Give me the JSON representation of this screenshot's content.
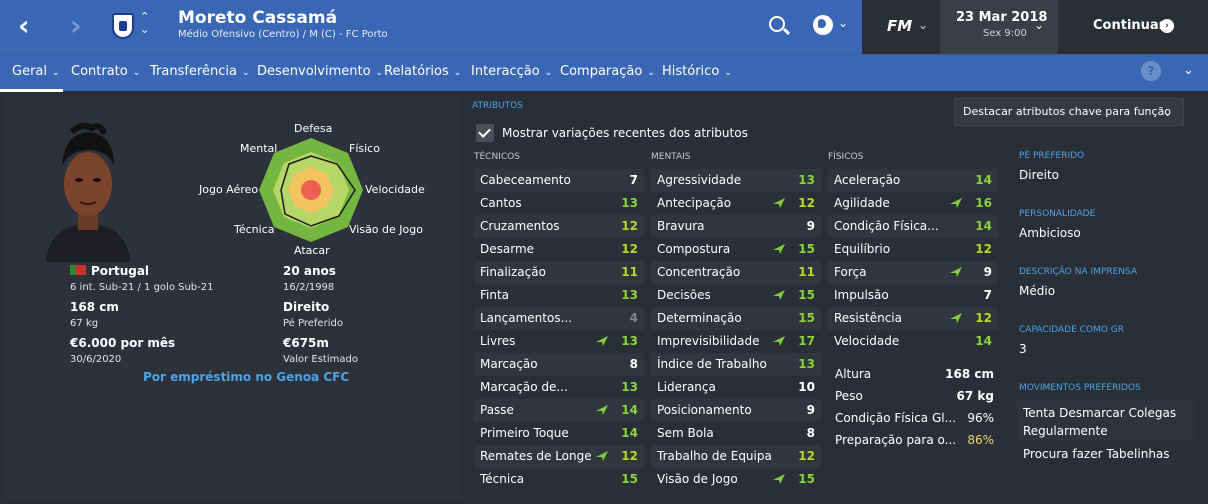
{
  "header": {
    "player_name": "Moreto Cassamá",
    "player_sub": "Médio Ofensivo (Centro) / M (C) - FC Porto",
    "fm_logo": "FM",
    "date": "23 Mar 2018",
    "day_time": "Sex 9:00",
    "continue_label": "Continuar",
    "icons": [
      "back-arrow-icon",
      "forward-arrow-icon",
      "club-crest-icon",
      "search-icon",
      "globe-icon",
      "help-icon"
    ]
  },
  "tabs": [
    {
      "label": "Geral"
    },
    {
      "label": "Contrato"
    },
    {
      "label": "Transferência"
    },
    {
      "label": "Desenvolvimento"
    },
    {
      "label": "Relatórios"
    },
    {
      "label": "Interacção"
    },
    {
      "label": "Comparação"
    },
    {
      "label": "Histórico"
    }
  ],
  "profile": {
    "radar_labels": {
      "defesa": "Defesa",
      "mental": "Mental",
      "fisico": "Físico",
      "jogo_aereo": "Jogo Aéreo",
      "velocidade": "Velocidade",
      "tecnica": "Técnica",
      "visao": "Visão de Jogo",
      "atacar": "Atacar"
    },
    "nationality": "Portugal",
    "caps": "6 int. Sub-21 / 1 golo Sub-21",
    "age": "20 anos",
    "dob": "16/2/1998",
    "height": "168 cm",
    "weight": "67 kg",
    "foot": "Direito",
    "foot_label": "Pé Preferido",
    "wage": "€6.000 por mês",
    "contract_end": "30/6/2020",
    "value": "€675m",
    "value_label": "Valor Estimado",
    "loan": "Por empréstimo no Genoa CFC"
  },
  "attributes": {
    "section_title": "ATRIBUTOS",
    "show_changes_label": "Mostrar variações recentes dos atributos",
    "highlight_button": "Destacar atributos chave para função",
    "columns": [
      {
        "title": "TÉCNICOS",
        "rows": [
          {
            "name": "Cabeceamento",
            "value": "7",
            "up": false
          },
          {
            "name": "Cantos",
            "value": "13",
            "up": false
          },
          {
            "name": "Cruzamentos",
            "value": "12",
            "up": false
          },
          {
            "name": "Desarme",
            "value": "12",
            "up": false
          },
          {
            "name": "Finalização",
            "value": "11",
            "up": false
          },
          {
            "name": "Finta",
            "value": "13",
            "up": false
          },
          {
            "name": "Lançamentos...",
            "value": "4",
            "up": false
          },
          {
            "name": "Livres",
            "value": "13",
            "up": true
          },
          {
            "name": "Marcação",
            "value": "8",
            "up": false
          },
          {
            "name": "Marcação de...",
            "value": "13",
            "up": false
          },
          {
            "name": "Passe",
            "value": "14",
            "up": true
          },
          {
            "name": "Primeiro Toque",
            "value": "14",
            "up": false
          },
          {
            "name": "Remates de Longe",
            "value": "12",
            "up": true
          },
          {
            "name": "Técnica",
            "value": "15",
            "up": false
          }
        ]
      },
      {
        "title": "MENTAIS",
        "rows": [
          {
            "name": "Agressividade",
            "value": "13",
            "up": false
          },
          {
            "name": "Antecipação",
            "value": "12",
            "up": true
          },
          {
            "name": "Bravura",
            "value": "9",
            "up": false
          },
          {
            "name": "Compostura",
            "value": "15",
            "up": true
          },
          {
            "name": "Concentração",
            "value": "11",
            "up": false
          },
          {
            "name": "Decisões",
            "value": "15",
            "up": true
          },
          {
            "name": "Determinação",
            "value": "15",
            "up": false
          },
          {
            "name": "Imprevisibilidade",
            "value": "17",
            "up": true
          },
          {
            "name": "Índice de Trabalho",
            "value": "13",
            "up": false
          },
          {
            "name": "Liderança",
            "value": "10",
            "up": false
          },
          {
            "name": "Posicionamento",
            "value": "9",
            "up": false
          },
          {
            "name": "Sem Bola",
            "value": "8",
            "up": false
          },
          {
            "name": "Trabalho de Equipa",
            "value": "12",
            "up": false
          },
          {
            "name": "Visão de Jogo",
            "value": "15",
            "up": true
          }
        ]
      },
      {
        "title": "FÍSICOS",
        "rows": [
          {
            "name": "Aceleração",
            "value": "14",
            "up": false
          },
          {
            "name": "Agilidade",
            "value": "16",
            "up": true
          },
          {
            "name": "Condição Física...",
            "value": "14",
            "up": false
          },
          {
            "name": "Equilíbrio",
            "value": "12",
            "up": false
          },
          {
            "name": "Força",
            "value": "9",
            "up": true
          },
          {
            "name": "Impulsão",
            "value": "7",
            "up": false
          },
          {
            "name": "Resistência",
            "value": "12",
            "up": true
          },
          {
            "name": "Velocidade",
            "value": "14",
            "up": false
          }
        ]
      }
    ],
    "physical_extra": [
      {
        "name": "Altura",
        "value": "168 cm"
      },
      {
        "name": "Peso",
        "value": "67 kg"
      },
      {
        "name": "Condição Física Gl...",
        "value": "96%"
      },
      {
        "name": "Preparação para o...",
        "value": "86%"
      }
    ]
  },
  "side": {
    "foot_title": "PÉ PREFERIDO",
    "foot": "Direito",
    "personality_title": "PERSONALIDADE",
    "personality": "Ambicioso",
    "media_title": "DESCRIÇÃO NA IMPRENSA",
    "media": "Médio",
    "gk_title": "CAPACIDADE COMO GR",
    "gk": "3",
    "moves_title": "MOVIMENTOS PREFERIDOS",
    "moves": [
      "Tenta Desmarcar Colegas Regularmente",
      "Procura fazer Tabelinhas"
    ]
  },
  "colors": {
    "accent": "#3a67b4",
    "link": "#4da3e6",
    "high": "#8cd23c",
    "mid": "#b8d82a",
    "low": "#808791",
    "up_arrow": "#7fcf3a"
  }
}
